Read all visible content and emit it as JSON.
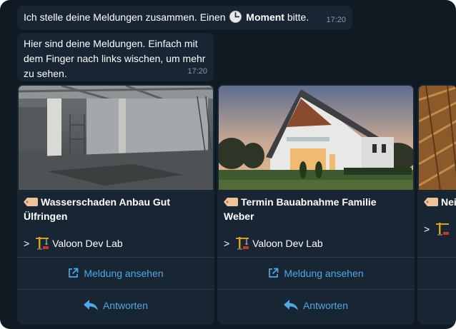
{
  "chat": {
    "message1": {
      "text_before": "Ich stelle deine Meldungen zusammen. Einen",
      "bold": "Moment",
      "text_after": "bitte.",
      "time": "17:20"
    },
    "message2": {
      "text": "Hier sind deine Meldungen. Einfach mit dem Finger nach links wischen, um mehr zu sehen.",
      "time": "17:20"
    }
  },
  "cards": [
    {
      "title": "Wasserschaden Anbau Gut Ülfringen",
      "team_prefix": ">",
      "team": "Valoon Dev Lab",
      "view_label": "Meldung ansehen",
      "reply_label": "Antworten"
    },
    {
      "title": "Termin Bauabnahme Familie Weber",
      "team_prefix": ">",
      "team": "Valoon Dev Lab",
      "view_label": "Meldung ansehen",
      "reply_label": "Antworten"
    },
    {
      "title": "Nei",
      "team_prefix": ">"
    }
  ],
  "colors": {
    "background": "#0f1a22",
    "bubble": "#182533",
    "link": "#4fa8e6",
    "time": "#8a9aa9"
  },
  "icons": [
    "clock-icon",
    "label-tag-icon",
    "crane-icon",
    "external-link-icon",
    "reply-arrow-icon"
  ]
}
